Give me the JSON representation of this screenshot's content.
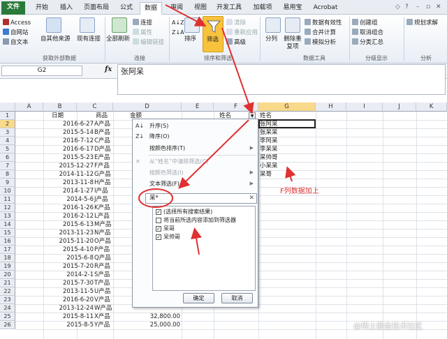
{
  "tabs": [
    "文件",
    "开始",
    "插入",
    "页面布局",
    "公式",
    "数据",
    "审阅",
    "视图",
    "开发工具",
    "加载项",
    "易用宝",
    "Acrobat"
  ],
  "ribbon": {
    "ext": [
      "Access",
      "自网站",
      "自文本"
    ],
    "other_src": "自其他来源",
    "existing": "现有连接",
    "group_ext": "获取外部数据",
    "refresh": "全部刷新",
    "conn_items": [
      "连接",
      "属性",
      "编辑链接"
    ],
    "group_conn": "连接",
    "sort": "排序",
    "filter": "筛选",
    "adv_items": [
      "清除",
      "重新应用",
      "高级"
    ],
    "group_sort": "排序和筛选",
    "split": "分列",
    "remove_dup": "删除重复项",
    "tools_items": [
      "数据有效性",
      "合并计算",
      "模拟分析"
    ],
    "group_tools": "数据工具",
    "outline_items": [
      "创建组",
      "取消组合",
      "分类汇总"
    ],
    "group_outline": "分级显示",
    "solver": "规划求解",
    "group_analysis": "分析"
  },
  "namebox": "G2",
  "fx": "fx",
  "formula": "张阿呆",
  "columns": [
    "A",
    "B",
    "C",
    "D",
    "E",
    "F",
    "G",
    "H",
    "I",
    "J",
    "K"
  ],
  "rows": [
    "1",
    "2",
    "3",
    "4",
    "5",
    "6",
    "7",
    "8",
    "9",
    "10",
    "11",
    "12",
    "13",
    "14",
    "15",
    "16",
    "17",
    "18",
    "19",
    "20",
    "21",
    "22",
    "23",
    "24",
    "25",
    "26"
  ],
  "headers": {
    "date": "日期",
    "product": "商品",
    "amount": "金额",
    "name_f": "姓名",
    "name_g": "姓名"
  },
  "dates": [
    "2016-6-27",
    "2015-5-14",
    "2016-7-12",
    "2016-6-17",
    "2015-5-23",
    "2015-12-27",
    "2014-11-12",
    "2013-11-8",
    "2014-1-27",
    "2014-5-6",
    "2016-1-26",
    "2016-2-12",
    "2015-6-13",
    "2013-11-23",
    "2015-11-20",
    "2015-4-10",
    "2015-6-8",
    "2015-7-20",
    "2014-2-1",
    "2015-7-30",
    "2013-11-5",
    "2016-6-20",
    "2013-12-24",
    "2015-8-11",
    "2015-8-5"
  ],
  "products": [
    "A产品",
    "B产品",
    "C产品",
    "D产品",
    "E产品",
    "F产品",
    "G产品",
    "H产品",
    "I产品",
    "J产品",
    "K产品",
    "L产品",
    "M产品",
    "N产品",
    "O产品",
    "P产品",
    "Q产品",
    "R产品",
    "S产品",
    "T产品",
    "U产品",
    "V产品",
    "W产品",
    "X产品",
    "Y产品"
  ],
  "amounts_visible": {
    "row25": "32,800.00",
    "row26": "25,000.00"
  },
  "gnames": [
    "张阿呆",
    "张呆呆",
    "李阿呆",
    "李呆呆",
    "呆帅哥",
    "小呆呆",
    "呆哥"
  ],
  "menu": {
    "asc": "升序(S)",
    "desc": "降序(O)",
    "by_color": "按颜色排序(T)",
    "clear": "从“姓名”中清除筛选(C)",
    "by_color_filter": "按颜色筛选(I)",
    "text_filter": "文本筛选(F)",
    "search": "呆*",
    "items": [
      {
        "label": "(选择所有搜索结果)",
        "checked": true
      },
      {
        "label": "将当前所选内容添加到筛选器",
        "checked": false
      },
      {
        "label": "呆哥",
        "checked": true
      },
      {
        "label": "呆帅哥",
        "checked": true
      }
    ],
    "ok": "确定",
    "cancel": "取消"
  },
  "annotation": "F列数据加上",
  "watermark": "@稀土掘金技术社区",
  "colors": {
    "file_tab": "#2b7a3a",
    "arrow": "#e03030",
    "filter_highlight": "#f9c23c"
  }
}
